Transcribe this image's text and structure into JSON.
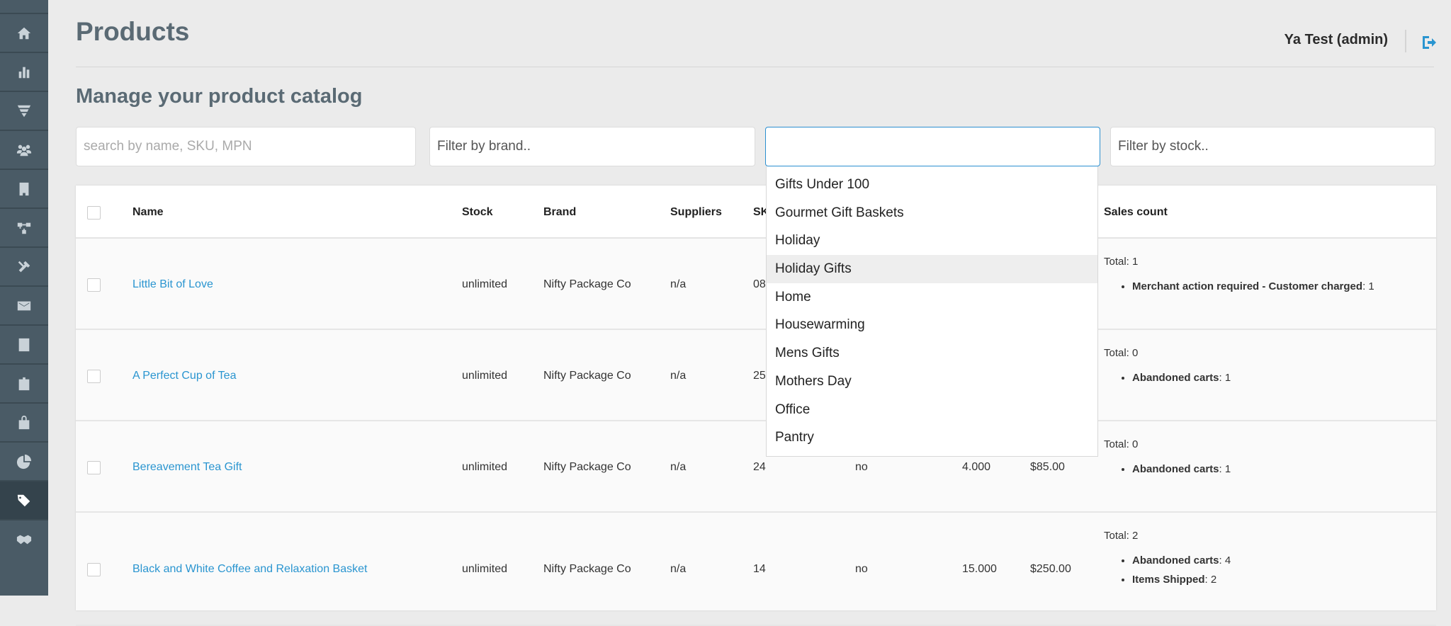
{
  "sidebar": {
    "items": [
      {
        "icon": "home-icon"
      },
      {
        "icon": "bar-chart-icon"
      },
      {
        "icon": "funnel-icon"
      },
      {
        "icon": "users-icon"
      },
      {
        "icon": "building-icon"
      },
      {
        "icon": "sitemap-icon"
      },
      {
        "icon": "tools-icon"
      },
      {
        "icon": "mail-icon"
      },
      {
        "icon": "report-icon"
      },
      {
        "icon": "id-badge-icon"
      },
      {
        "icon": "shopping-bag-icon"
      },
      {
        "icon": "pie-chart-icon"
      },
      {
        "icon": "tags-icon",
        "active": true
      },
      {
        "icon": "handshake-icon"
      }
    ]
  },
  "header": {
    "title": "Products",
    "user": "Ya Test (admin)",
    "logout_icon": "sign-out-icon"
  },
  "subtitle": "Manage your product catalog",
  "filters": {
    "search_placeholder": "search by name, SKU, MPN",
    "brand_placeholder": "Filter by brand..",
    "category_value": "",
    "stock_placeholder": "Filter by stock.."
  },
  "category_dropdown": {
    "options": [
      "Gifts Under 100",
      "Gourmet Gift Baskets",
      "Holiday",
      "Holiday Gifts",
      "Home",
      "Housewarming",
      "Mens Gifts",
      "Mothers Day",
      "Office",
      "Pantry"
    ],
    "highlighted": "Holiday Gifts"
  },
  "table": {
    "headers": {
      "name": "Name",
      "stock": "Stock",
      "brand": "Brand",
      "suppliers": "Suppliers",
      "sku": "SKU",
      "sales": "Sales count"
    },
    "rows": [
      {
        "name": "Little Bit of Love",
        "stock": "unlimited",
        "brand": "Nifty Package Co",
        "suppliers": "n/a",
        "sku": "08",
        "c6": "",
        "c7": "",
        "c8": "",
        "total": "Total: 1",
        "sales": [
          {
            "k": "Merchant action required - Customer charged",
            "v": ": 1"
          }
        ]
      },
      {
        "name": "A Perfect Cup of Tea",
        "stock": "unlimited",
        "brand": "Nifty Package Co",
        "suppliers": "n/a",
        "sku": "25",
        "c6": "",
        "c7": "",
        "c8": "",
        "total": "Total: 0",
        "sales": [
          {
            "k": "Abandoned carts",
            "v": ": 1"
          }
        ]
      },
      {
        "name": "Bereavement Tea Gift",
        "stock": "unlimited",
        "brand": "Nifty Package Co",
        "suppliers": "n/a",
        "sku": "24",
        "c6": "no",
        "c7": "4.000",
        "c8": "$85.00",
        "total": "Total: 0",
        "sales": [
          {
            "k": "Abandoned carts",
            "v": ": 1"
          }
        ]
      },
      {
        "name": "Black and White Coffee and Relaxation Basket",
        "stock": "unlimited",
        "brand": "Nifty Package Co",
        "suppliers": "n/a",
        "sku": "14",
        "c6": "no",
        "c7": "15.000",
        "c8": "$250.00",
        "total": "Total: 2",
        "sales": [
          {
            "k": "Abandoned carts",
            "v": ": 4"
          },
          {
            "k": "Items Shipped",
            "v": ": 2"
          }
        ]
      }
    ]
  },
  "colors": {
    "sidebar": "#4a5b66",
    "link": "#2a95d0",
    "focus": "#2b8fd0"
  }
}
